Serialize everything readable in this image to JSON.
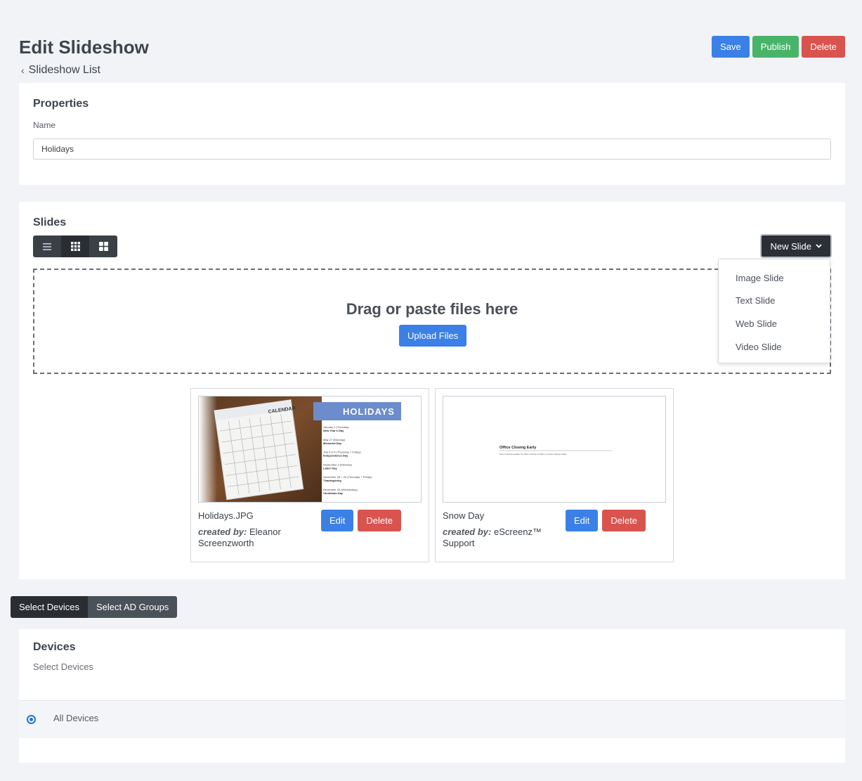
{
  "header": {
    "title": "Edit Slideshow",
    "back_label": "Slideshow List",
    "save_label": "Save",
    "publish_label": "Publish",
    "delete_label": "Delete"
  },
  "properties": {
    "title": "Properties",
    "name_label": "Name",
    "name_value": "Holidays"
  },
  "slides": {
    "title": "Slides",
    "view_modes": [
      "list",
      "grid-small",
      "grid-large"
    ],
    "active_view": "grid-small",
    "new_slide_label": "New Slide",
    "new_slide_menu": [
      "Image Slide",
      "Text Slide",
      "Web Slide",
      "Video Slide"
    ],
    "dropzone_text": "Drag or paste files here",
    "upload_label": "Upload Files",
    "items": [
      {
        "name": "Holidays.JPG",
        "created_by_label": "created by:",
        "created_by": "Eleanor Screenzworth",
        "edit_label": "Edit",
        "delete_label": "Delete",
        "thumbnail": {
          "banner": "HOLIDAYS",
          "calendar_label": "CALENDAR",
          "entries": [
            {
              "date": "January 1 (Tuesday)",
              "name": "New Year's Day"
            },
            {
              "date": "May 27 (Monday)",
              "name": "Memorial Day"
            },
            {
              "date": "July 4 & 5 (Thursday + Friday)",
              "name": "Independence Day"
            },
            {
              "date": "September 2 (Monday)",
              "name": "Labor Day"
            },
            {
              "date": "November 28 + 29 (Thursday + Friday)",
              "name": "Thanksgiving"
            },
            {
              "date": "December 25 (Wednesday)",
              "name": "Christmas Day"
            }
          ]
        }
      },
      {
        "name": "Snow Day",
        "created_by_label": "created by:",
        "created_by": "eScreenz™ Support",
        "edit_label": "Edit",
        "delete_label": "Delete",
        "thumbnail": {
          "heading": "Office Closing Early",
          "body": "Due to inclement weather the office is closing at 2:00pm to ensure employee safety."
        }
      }
    ]
  },
  "target_tabs": {
    "devices_label": "Select Devices",
    "ad_groups_label": "Select AD Groups",
    "active": "Select Devices"
  },
  "devices": {
    "title": "Devices",
    "subtitle": "Select Devices",
    "option_label": "All Devices",
    "option_selected": true
  },
  "colors": {
    "primary": "#3b80e6",
    "success": "#48b46a",
    "danger": "#d9534f",
    "dark": "#2c3036"
  }
}
